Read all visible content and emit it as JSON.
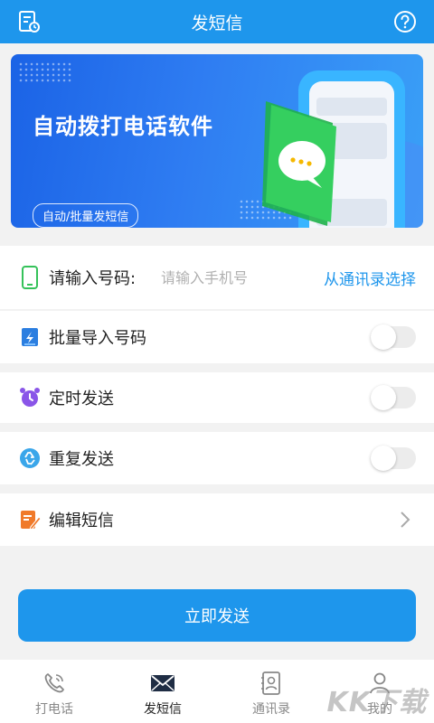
{
  "header": {
    "title": "发短信",
    "left_icon": "task-list-clock-icon",
    "right_icon": "help-icon"
  },
  "banner": {
    "title": "自动拨打电话软件",
    "subtitle": "自动/批量发短信"
  },
  "phone_row": {
    "label": "请输入号码:",
    "placeholder": "请输入手机号",
    "value": "",
    "contacts_link": "从通讯录选择"
  },
  "options": [
    {
      "label": "批量导入号码",
      "icon": "import-icon",
      "enabled": false
    },
    {
      "label": "定时发送",
      "icon": "alarm-clock-icon",
      "enabled": false
    },
    {
      "label": "重复发送",
      "icon": "recycle-icon",
      "enabled": false
    }
  ],
  "edit_row": {
    "label": "编辑短信",
    "icon": "edit-icon"
  },
  "send_button": "立即发送",
  "bottom_nav": [
    {
      "label": "打电话",
      "icon": "phone-icon",
      "active": false
    },
    {
      "label": "发短信",
      "icon": "envelope-icon",
      "active": true
    },
    {
      "label": "通讯录",
      "icon": "contacts-book-icon",
      "active": false
    },
    {
      "label": "我的",
      "icon": "user-icon",
      "active": false
    }
  ],
  "watermark": "KK下载",
  "colors": {
    "primary": "#1e96ec",
    "banner_start": "#1b63e6",
    "banner_end": "#3aa0f7",
    "background": "#f2f2f2",
    "toggle_off": "#ececec"
  }
}
